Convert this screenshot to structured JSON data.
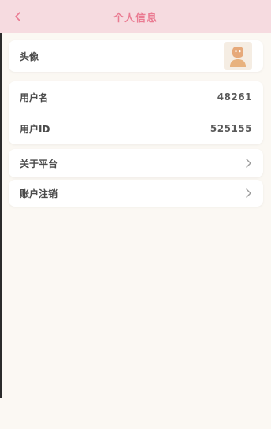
{
  "header": {
    "title": "个人信息",
    "accent_color": "#ea7b92",
    "background_color": "#f6dbe0"
  },
  "avatar_row": {
    "label": "头像",
    "avatar_icon": "person-avatar-icon"
  },
  "account_info": {
    "username_label": "用户名",
    "username_value": "48261",
    "userid_label": "用户ID",
    "userid_value": "525155"
  },
  "menu": {
    "about_label": "关于平台",
    "delete_label": "账户注销",
    "chevron_icon": "chevron-right-icon"
  }
}
